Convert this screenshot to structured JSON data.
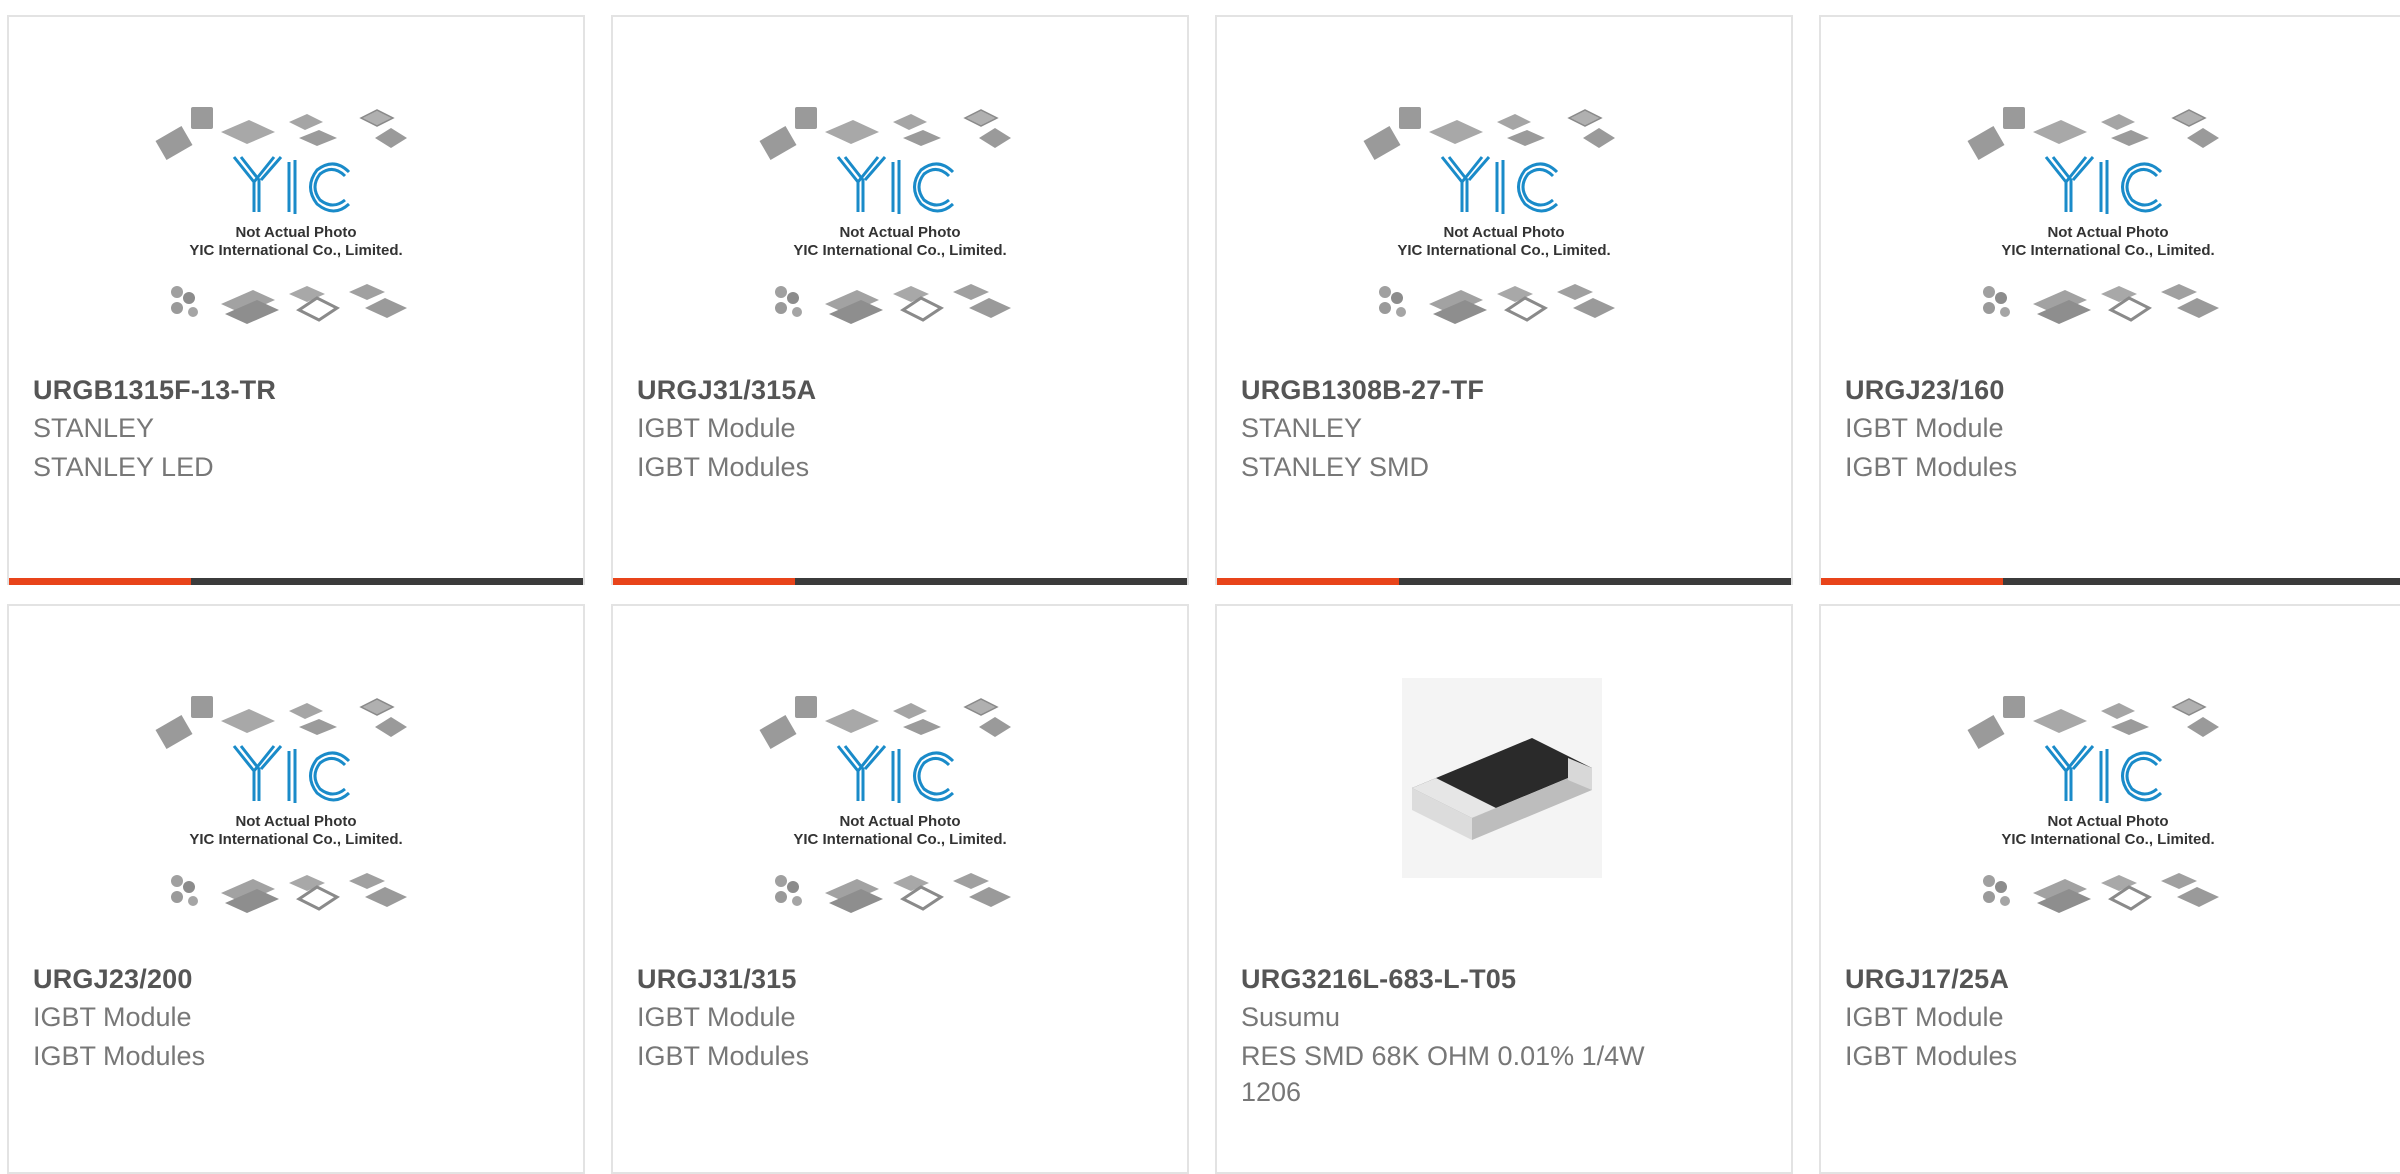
{
  "placeholder": {
    "caption_line1": "Not Actual Photo",
    "caption_line2": "YIC International Co., Limited.",
    "logo_text": "YIC"
  },
  "colors": {
    "accent": "#e8441a",
    "bar": "#3b3b3b",
    "logo_blue": "#1a8bc9",
    "part_number": "#555555",
    "meta_text": "#777777"
  },
  "products": [
    {
      "part_number": "URGB1315F-13-TR",
      "manufacturer": "STANLEY",
      "description": "STANLEY LED",
      "image": "placeholder"
    },
    {
      "part_number": "URGJ31/315A",
      "manufacturer": "IGBT Module",
      "description": "IGBT Modules",
      "image": "placeholder"
    },
    {
      "part_number": "URGB1308B-27-TF",
      "manufacturer": "STANLEY",
      "description": "STANLEY SMD",
      "image": "placeholder"
    },
    {
      "part_number": "URGJ23/160",
      "manufacturer": "IGBT Module",
      "description": "IGBT Modules",
      "image": "placeholder"
    },
    {
      "part_number": "URGJ23/200",
      "manufacturer": "IGBT Module",
      "description": "IGBT Modules",
      "image": "placeholder"
    },
    {
      "part_number": "URGJ31/315",
      "manufacturer": "IGBT Module",
      "description": "IGBT Modules",
      "image": "placeholder"
    },
    {
      "part_number": "URG3216L-683-L-T05",
      "manufacturer": "Susumu",
      "description": "RES SMD 68K OHM 0.01% 1/4W 1206",
      "image": "smd-resistor-photo"
    },
    {
      "part_number": "URGJ17/25A",
      "manufacturer": "IGBT Module",
      "description": "IGBT Modules",
      "image": "placeholder"
    }
  ]
}
